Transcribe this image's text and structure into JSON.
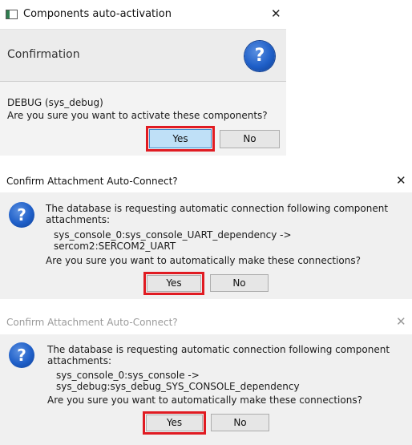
{
  "dialog1": {
    "title": "Components auto-activation",
    "header": "Confirmation",
    "component": "DEBUG (sys_debug)",
    "question": "Are you sure you want to activate these components?",
    "yes_label": "Yes",
    "no_label": "No",
    "help_glyph": "?"
  },
  "dialog2": {
    "title": "Confirm Attachment Auto-Connect?",
    "message": "The database is requesting automatic connection following component attachments:",
    "connection": "sys_console_0:sys_console_UART_dependency -> sercom2:SERCOM2_UART",
    "question": "Are you sure you want to automatically make these connections?",
    "yes_label": "Yes",
    "no_label": "No",
    "icon_glyph": "?"
  },
  "dialog3": {
    "title": "Confirm Attachment Auto-Connect?",
    "message": "The database is requesting automatic connection following component attachments:",
    "connection": "sys_console_0:sys_console -> sys_debug:sys_debug_SYS_CONSOLE_dependency",
    "question": "Are you sure you want to automatically make these connections?",
    "yes_label": "Yes",
    "no_label": "No",
    "icon_glyph": "?"
  },
  "close_glyph": "✕"
}
